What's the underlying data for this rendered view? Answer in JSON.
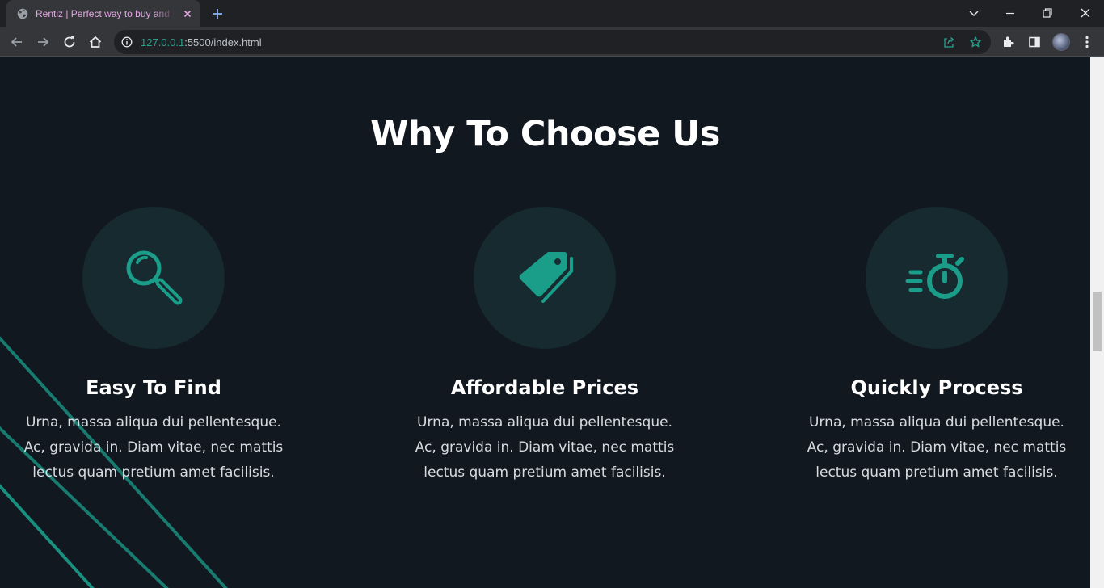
{
  "browser": {
    "tab_title": "Rentiz | Perfect way to buy and sell",
    "url_host": "127.0.0.1",
    "url_rest": ":5500/index.html"
  },
  "colors": {
    "page_bg": "#111820",
    "accent": "#1a9e8a",
    "icon_circle": "#162a30",
    "text": "#ffffff"
  },
  "section": {
    "title": "Why To Choose Us"
  },
  "features": [
    {
      "icon": "magnifying-glass-icon",
      "title": "Easy To Find",
      "lines": [
        "Urna, massa aliqua dui pellentesque.",
        "Ac, gravida in. Diam vitae, nec mattis",
        "lectus quam pretium amet facilisis."
      ]
    },
    {
      "icon": "price-tag-icon",
      "title": "Affordable Prices",
      "lines": [
        "Urna, massa aliqua dui pellentesque.",
        "Ac, gravida in. Diam vitae, nec mattis",
        "lectus quam pretium amet facilisis."
      ]
    },
    {
      "icon": "stopwatch-icon",
      "title": "Quickly Process",
      "lines": [
        "Urna, massa aliqua dui pellentesque.",
        "Ac, gravida in. Diam vitae, nec mattis",
        "lectus quam pretium amet facilisis."
      ]
    }
  ]
}
